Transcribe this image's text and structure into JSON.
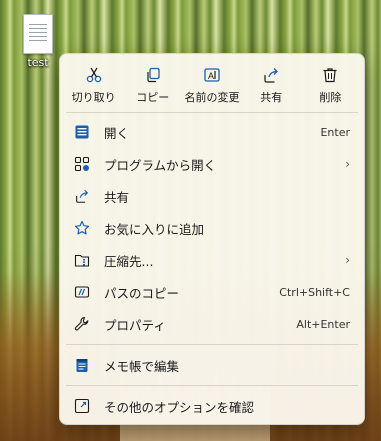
{
  "desktop": {
    "file_label": "test"
  },
  "context_menu": {
    "quick_actions": [
      {
        "label": "切り取り",
        "icon": "scissors-icon"
      },
      {
        "label": "コピー",
        "icon": "copy-icon"
      },
      {
        "label": "名前の変更",
        "icon": "rename-icon"
      },
      {
        "label": "共有",
        "icon": "share-icon"
      },
      {
        "label": "削除",
        "icon": "trash-icon"
      }
    ],
    "items": [
      {
        "label": "開く",
        "shortcut": "Enter",
        "icon": "open-icon"
      },
      {
        "label": "プログラムから開く",
        "icon": "open-with-icon",
        "submenu": true
      },
      {
        "label": "共有",
        "icon": "share-icon"
      },
      {
        "label": "お気に入りに追加",
        "icon": "star-icon"
      },
      {
        "label": "圧縮先...",
        "icon": "zip-folder-icon",
        "submenu": true
      },
      {
        "label": "パスのコピー",
        "shortcut": "Ctrl+Shift+C",
        "icon": "path-copy-icon"
      },
      {
        "label": "プロパティ",
        "shortcut": "Alt+Enter",
        "icon": "wrench-icon"
      },
      {
        "label": "メモ帳で編集",
        "icon": "notepad-icon"
      },
      {
        "label": "その他のオプションを確認",
        "icon": "more-options-icon"
      }
    ],
    "accent_color": "#1a5fb4"
  }
}
